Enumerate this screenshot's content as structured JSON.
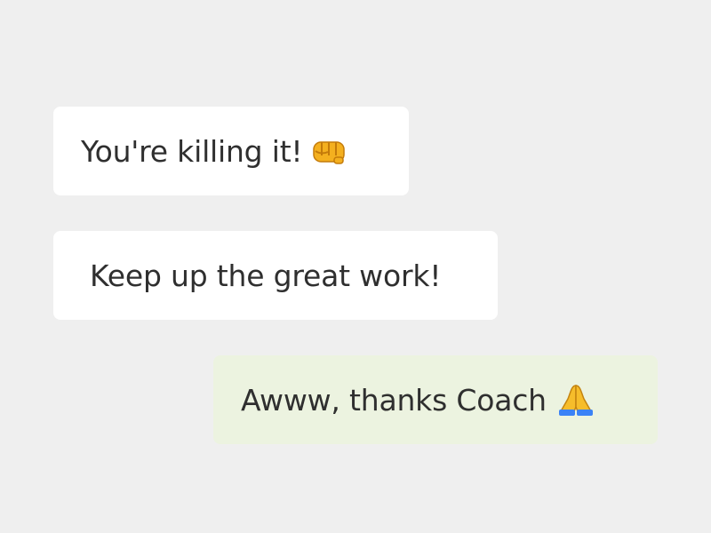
{
  "conversation": {
    "messages": [
      {
        "text": "You're killing it!",
        "emoji": "oncoming-fist",
        "sender": "coach",
        "bubble_color": "#ffffff"
      },
      {
        "text": "Keep up the great work!",
        "emoji": "",
        "sender": "coach",
        "bubble_color": "#ffffff"
      },
      {
        "text": "Awww, thanks Coach",
        "emoji": "folded-hands",
        "sender": "user",
        "bubble_color": "#ecf3e0"
      }
    ]
  },
  "colors": {
    "background": "#efefef",
    "text": "#2f2f2f",
    "incoming_bubble": "#ffffff",
    "outgoing_bubble": "#ecf3e0"
  }
}
